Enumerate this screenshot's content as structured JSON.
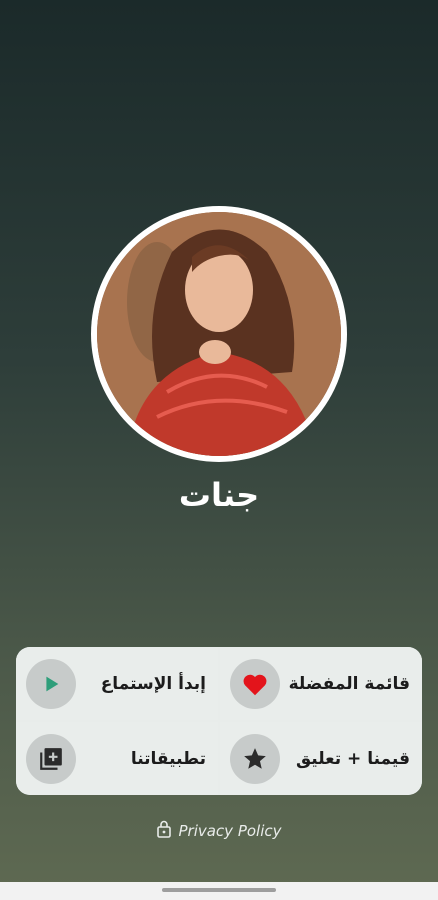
{
  "artist": {
    "name": "جنات"
  },
  "menu": {
    "favorites_label": "قائمة المفضلة",
    "start_listening_label": "إبدأ الإستماع",
    "rate_label": "قيمنا + تعليق",
    "our_apps_label": "تطبيقاتنا"
  },
  "icons": {
    "favorites": "heart-icon",
    "start_listening": "play-icon",
    "rate": "star-icon",
    "our_apps": "add-library-icon",
    "privacy": "lock-icon"
  },
  "colors": {
    "heart": "#e3141b",
    "play": "#2e9e7a",
    "menu_bg": "#e9edeb",
    "icon_circle": "#c7cbca"
  },
  "footer": {
    "privacy_label": "Privacy Policy"
  }
}
